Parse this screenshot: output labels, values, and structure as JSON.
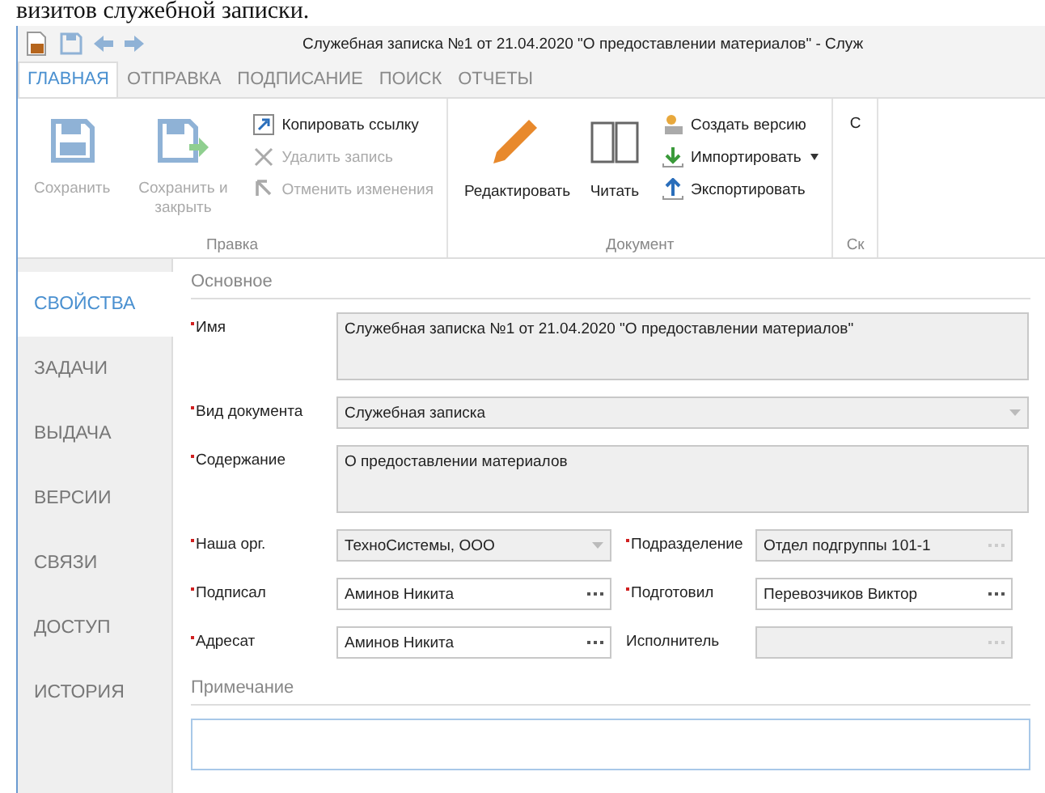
{
  "caption": "визитов служебной записки.",
  "window": {
    "title": "Служебная записка №1 от 21.04.2020 \"О предоставлении материалов\" - Служ"
  },
  "tabs": [
    {
      "label": "ГЛАВНАЯ",
      "selected": true
    },
    {
      "label": "ОТПРАВКА",
      "selected": false
    },
    {
      "label": "ПОДПИСАНИЕ",
      "selected": false
    },
    {
      "label": "ПОИСК",
      "selected": false
    },
    {
      "label": "ОТЧЕТЫ",
      "selected": false
    }
  ],
  "ribbon": [
    {
      "label": "Правка",
      "large": [
        {
          "label": "Сохранить",
          "kind": "save",
          "disabled": true
        },
        {
          "label": "Сохранить и закрыть",
          "kind": "saveclose",
          "disabled": true
        }
      ],
      "small": [
        {
          "label": "Копировать ссылку",
          "kind": "link",
          "disabled": false
        },
        {
          "label": "Удалить запись",
          "kind": "delete",
          "disabled": true
        },
        {
          "label": "Отменить изменения",
          "kind": "undo",
          "disabled": true
        }
      ]
    },
    {
      "label": "Документ",
      "large": [
        {
          "label": "Редактировать",
          "kind": "edit",
          "disabled": false
        },
        {
          "label": "Читать",
          "kind": "read",
          "disabled": false
        }
      ],
      "small": [
        {
          "label": "Создать версию",
          "kind": "version",
          "disabled": false
        },
        {
          "label": "Импортировать",
          "kind": "import",
          "disabled": false,
          "dropdown": true
        },
        {
          "label": "Экспортировать",
          "kind": "export",
          "disabled": false
        }
      ]
    },
    {
      "label": "Ск",
      "large": [
        {
          "label": "С",
          "kind": "plain",
          "disabled": false
        }
      ]
    }
  ],
  "nav": [
    {
      "label": "СВОЙСТВА",
      "selected": true
    },
    {
      "label": "ЗАДАЧИ",
      "selected": false
    },
    {
      "label": "ВЫДАЧА",
      "selected": false
    },
    {
      "label": "ВЕРСИИ",
      "selected": false
    },
    {
      "label": "СВЯЗИ",
      "selected": false
    },
    {
      "label": "ДОСТУП",
      "selected": false
    },
    {
      "label": "ИСТОРИЯ",
      "selected": false
    }
  ],
  "form": {
    "section": "Основное",
    "rows": [
      [
        {
          "label": "Имя",
          "kind": "text",
          "required": true,
          "disabled": true,
          "value": "Служебная записка №1 от 21.04.2020 \"О предоставлении материалов\"",
          "tall": true
        }
      ],
      [
        {
          "label": "Вид документа",
          "kind": "dropdown",
          "required": true,
          "disabled": true,
          "value": "Служебная записка"
        }
      ],
      [
        {
          "label": "Содержание",
          "kind": "text",
          "required": true,
          "disabled": true,
          "value": "О предоставлении материалов",
          "tall": true
        }
      ],
      [
        {
          "label": "Наша орг.",
          "kind": "dropdown",
          "required": true,
          "disabled": true,
          "value": "ТехноСистемы, ООО"
        },
        {
          "label": "Подразделение",
          "kind": "lookup",
          "required": true,
          "disabled": true,
          "value": "Отдел подгруппы 101-1"
        }
      ],
      [
        {
          "label": "Подписал",
          "kind": "lookup",
          "required": true,
          "disabled": false,
          "value": "Аминов Никита"
        },
        {
          "label": "Подготовил",
          "kind": "lookup",
          "required": true,
          "disabled": false,
          "value": "Перевозчиков Виктор"
        }
      ],
      [
        {
          "label": "Адресат",
          "kind": "lookup",
          "required": true,
          "disabled": false,
          "value": "Аминов Никита"
        },
        {
          "label": "Исполнитель",
          "kind": "lookup",
          "required": false,
          "disabled": true
        }
      ]
    ],
    "note_section": "Примечание"
  }
}
